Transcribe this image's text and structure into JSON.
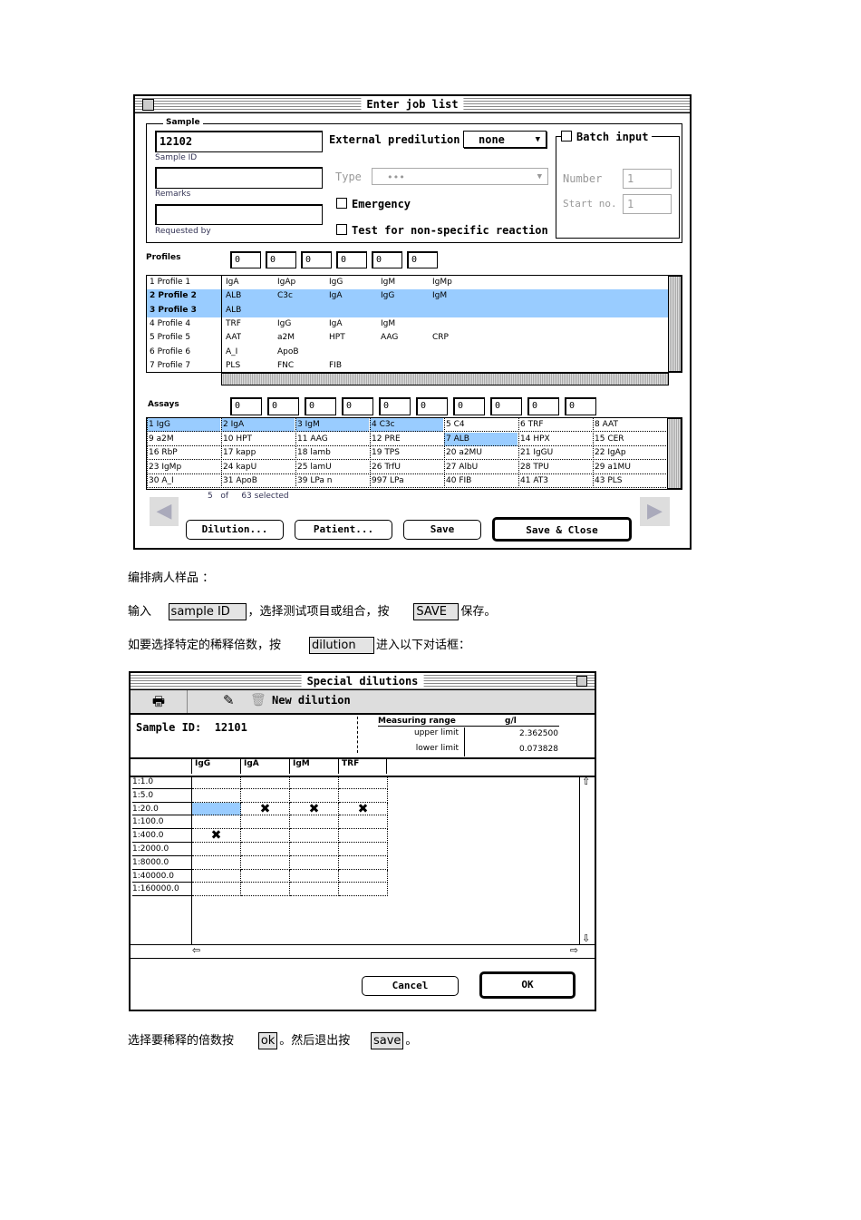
{
  "job_window": {
    "title": "Enter job list",
    "sample_group": "Sample",
    "sample_id_value": "12102",
    "sample_id_label": "Sample ID",
    "remarks_value": "",
    "remarks_label": "Remarks",
    "requested_value": "",
    "requested_label": "Requested by",
    "external_predilution_label": "External predilution",
    "external_predilution_value": "none",
    "type_label": "Type",
    "type_value": "•••",
    "emergency_label": "Emergency",
    "nonspecific_label": "Test for non-specific reaction",
    "batch_label": "Batch input",
    "number_label": "Number",
    "number_value": "1",
    "start_label": "Start no.",
    "start_value": "1",
    "profiles_label": "Profiles",
    "profile_boxes": [
      "0",
      "0",
      "0",
      "0",
      "0",
      "0"
    ],
    "profiles": [
      {
        "name": "1  Profile 1",
        "items": [
          "IgA",
          "IgAp",
          "IgG",
          "IgM",
          "IgMp"
        ],
        "selected": false
      },
      {
        "name": "2  Profile 2",
        "items": [
          "ALB",
          "C3c",
          "IgA",
          "IgG",
          "IgM"
        ],
        "selected": true
      },
      {
        "name": "3  Profile 3",
        "items": [
          "ALB"
        ],
        "selected": true
      },
      {
        "name": "4  Profile 4",
        "items": [
          "TRF",
          "IgG",
          "IgA",
          "IgM"
        ],
        "selected": false
      },
      {
        "name": "5  Profile 5",
        "items": [
          "AAT",
          "a2M",
          "HPT",
          "AAG",
          "CRP"
        ],
        "selected": false
      },
      {
        "name": "6  Profile 6",
        "items": [
          "A_I",
          "ApoB"
        ],
        "selected": false
      },
      {
        "name": "7  Profile 7",
        "items": [
          "PLS",
          "FNC",
          "FIB"
        ],
        "selected": false
      }
    ],
    "assays_label": "Assays",
    "assay_boxes": [
      "0",
      "0",
      "0",
      "0",
      "0",
      "0",
      "0",
      "0",
      "0",
      "0"
    ],
    "assays": [
      [
        "1 IgG",
        "2 IgA",
        "3 IgM",
        "4 C3c",
        "5 C4",
        "6 TRF",
        "8 AAT"
      ],
      [
        "9 a2M",
        "10 HPT",
        "11 AAG",
        "12 PRE",
        "7 ALB",
        "14 HPX",
        "15 CER"
      ],
      [
        "16 RbP",
        "17 kapp",
        "18 lamb",
        "19 TPS",
        "20 a2MU",
        "21 IgGU",
        "22 IgAp"
      ],
      [
        "23 IgMp",
        "24 kapU",
        "25 lamU",
        "26 TrfU",
        "27 AlbU",
        "28 TPU",
        "29 a1MU"
      ],
      [
        "30 A_I",
        "31 ApoB",
        "39 LPa n",
        "997 LPa",
        "40 FIB",
        "41 AT3",
        "43 PLS"
      ]
    ],
    "assays_selected": [
      [
        0,
        0
      ],
      [
        0,
        1
      ],
      [
        0,
        2
      ],
      [
        0,
        3
      ],
      [
        1,
        4
      ]
    ],
    "selection_count": "5",
    "selection_of": "of",
    "selection_total": "63 selected",
    "buttons": {
      "dilution": "Dilution...",
      "patient": "Patient...",
      "save": "Save",
      "save_close": "Save & Close"
    }
  },
  "text": {
    "line1": "编排病人样品 ：",
    "line2_a": "输入",
    "line2_box1": "sample ID",
    "line2_b": "，选择测试项目或组合，按",
    "line2_box2": "SAVE",
    "line2_c": "保存。",
    "line3_a": "如要选择特定的稀释倍数，按",
    "line3_box": "dilution",
    "line3_b": "进入以下对话框：",
    "line4_a": "选择要稀释的倍数按",
    "line4_box1": "ok",
    "line4_b": "。然后退出按",
    "line4_box2": "save",
    "line4_c": "。"
  },
  "dil_window": {
    "title": "Special dilutions",
    "new_dilution": "New dilution",
    "sample_id_label": "Sample ID:",
    "sample_id_value": "12101",
    "measuring_range": "Measuring range",
    "unit": "g/l",
    "upper_label": "upper limit",
    "upper_value": "2.362500",
    "lower_label": "lower limit",
    "lower_value": "0.073828",
    "columns": [
      "IgG",
      "IgA",
      "IgM",
      "TRF"
    ],
    "rows": [
      "1:1.0",
      "1:5.0",
      "1:20.0",
      "1:100.0",
      "1:400.0",
      "1:2000.0",
      "1:8000.0",
      "1:40000.0",
      "1:160000.0"
    ],
    "marks": [
      [
        2,
        1
      ],
      [
        2,
        2
      ],
      [
        2,
        3
      ],
      [
        4,
        0
      ]
    ],
    "highlight": [
      2,
      0
    ],
    "cancel": "Cancel",
    "ok": "OK"
  }
}
